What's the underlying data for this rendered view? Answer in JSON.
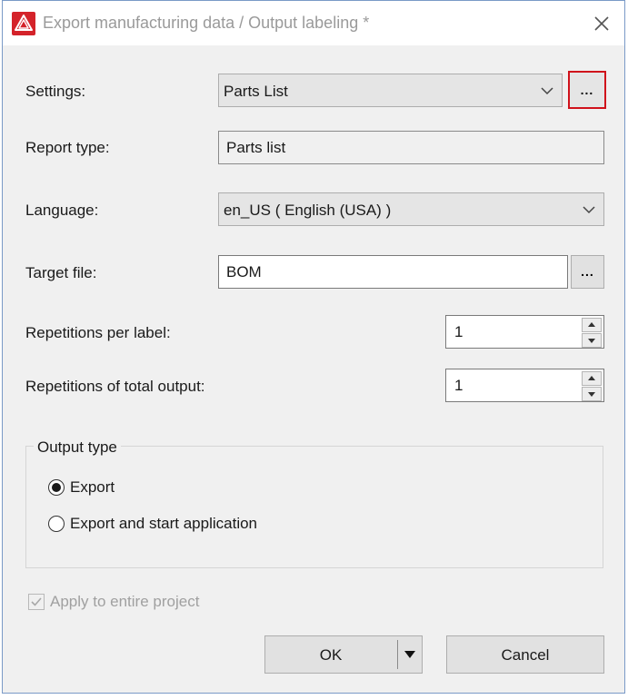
{
  "window": {
    "title": "Export manufacturing data / Output labeling *",
    "icon": "warning-triangle-icon",
    "accent_color": "#d4232a"
  },
  "settings": {
    "label": "Settings:",
    "value": "Parts List",
    "browse_label": "..."
  },
  "report_type": {
    "label": "Report type:",
    "value": "Parts list"
  },
  "language": {
    "label": "Language:",
    "value": "en_US ( English (USA) )"
  },
  "target_file": {
    "label": "Target file:",
    "value": "BOM",
    "browse_label": "..."
  },
  "repetitions_per_label": {
    "label": "Repetitions per label:",
    "value": "1"
  },
  "repetitions_total": {
    "label": "Repetitions of total output:",
    "value": "1"
  },
  "output_type": {
    "title": "Output type",
    "options": [
      {
        "label": "Export",
        "checked": true
      },
      {
        "label": "Export and start application",
        "checked": false
      }
    ]
  },
  "apply_entire_project": {
    "label": "Apply to entire project",
    "checked": true,
    "disabled": true
  },
  "buttons": {
    "ok": "OK",
    "cancel": "Cancel"
  }
}
